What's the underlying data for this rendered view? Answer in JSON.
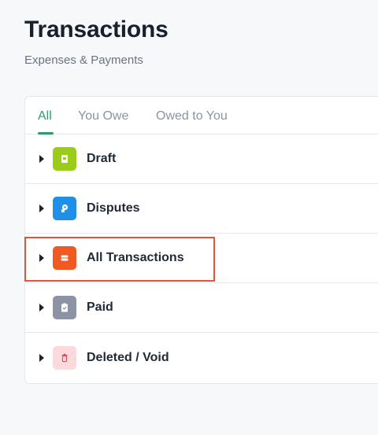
{
  "page": {
    "title": "Transactions",
    "subtitle": "Expenses & Payments"
  },
  "tabs": [
    {
      "label": "All",
      "active": true
    },
    {
      "label": "You Owe",
      "active": false
    },
    {
      "label": "Owed to You",
      "active": false
    }
  ],
  "rows": [
    {
      "label": "Draft",
      "icon": "draft-icon",
      "icon_bg": "#9ccc1a"
    },
    {
      "label": "Disputes",
      "icon": "disputes-icon",
      "icon_bg": "#1e90e8"
    },
    {
      "label": "All Transactions",
      "icon": "transactions-icon",
      "icon_bg": "#f05a22",
      "highlighted": true
    },
    {
      "label": "Paid",
      "icon": "paid-icon",
      "icon_bg": "#8b93a5"
    },
    {
      "label": "Deleted / Void",
      "icon": "trash-icon",
      "icon_bg": "#fbd9dc",
      "icon_fg": "#e04a5a"
    }
  ],
  "colors": {
    "accent": "#2f9b6a",
    "highlight": "#e0533f"
  }
}
